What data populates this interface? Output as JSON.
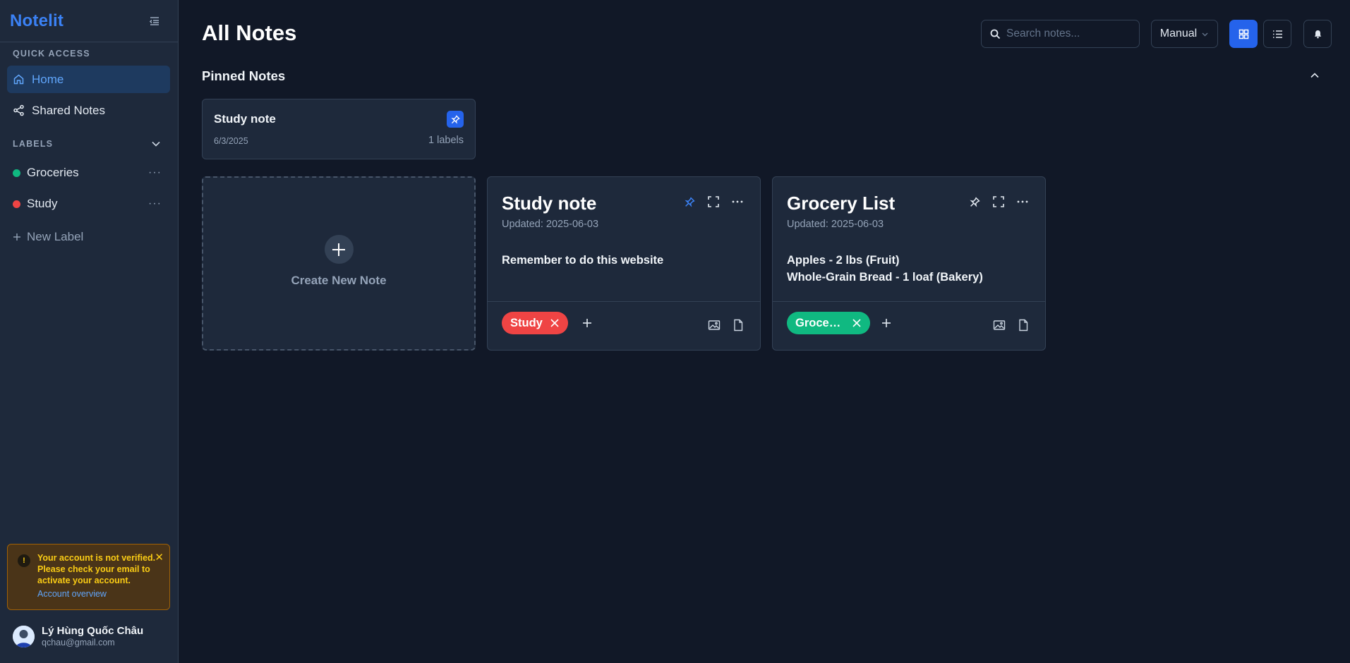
{
  "app": {
    "logo": "Notelit"
  },
  "sidebar": {
    "quick_access_title": "QUICK ACCESS",
    "nav": [
      {
        "label": "Home",
        "icon": "home-icon",
        "active": true
      },
      {
        "label": "Shared Notes",
        "icon": "share-icon",
        "active": false
      }
    ],
    "labels_title": "LABELS",
    "labels": [
      {
        "name": "Groceries",
        "color": "#10b981"
      },
      {
        "name": "Study",
        "color": "#ef4444"
      }
    ],
    "new_label": "New Label",
    "more_symbol": "···",
    "alert": {
      "icon_symbol": "!",
      "message": "Your account is not verified. Please check your email to activate your account.",
      "link": "Account overview",
      "close_symbol": "✕"
    },
    "user": {
      "name": "Lý Hùng Quốc Châu",
      "email": "qchau@gmail.com"
    }
  },
  "header": {
    "title": "All Notes",
    "search_placeholder": "Search notes...",
    "search_value": "",
    "sort_value": "Manual",
    "view_mode": "grid"
  },
  "pinned": {
    "title": "Pinned Notes",
    "cards": [
      {
        "title": "Study note",
        "date": "6/3/2025",
        "label_count": "1 labels"
      }
    ]
  },
  "grid": {
    "create_label": "Create New Note",
    "notes": [
      {
        "title": "Study note",
        "updated": "Updated: 2025-06-03",
        "lines": [
          "Remember to do this website"
        ],
        "tag": "Study",
        "tag_color": "#ef4444",
        "pinned": true
      },
      {
        "title": "Grocery List",
        "updated": "Updated: 2025-06-03",
        "lines": [
          "Apples - 2 lbs (Fruit)",
          "Whole-Grain Bread - 1 loaf (Bakery)"
        ],
        "tag": "Groceri…",
        "tag_color": "#10b981",
        "pinned": false
      }
    ]
  },
  "colors": {
    "accent": "#2563eb",
    "logo": "#3b82f6",
    "background": "#111827",
    "panel": "#1e293b",
    "warning": "#facc15"
  }
}
